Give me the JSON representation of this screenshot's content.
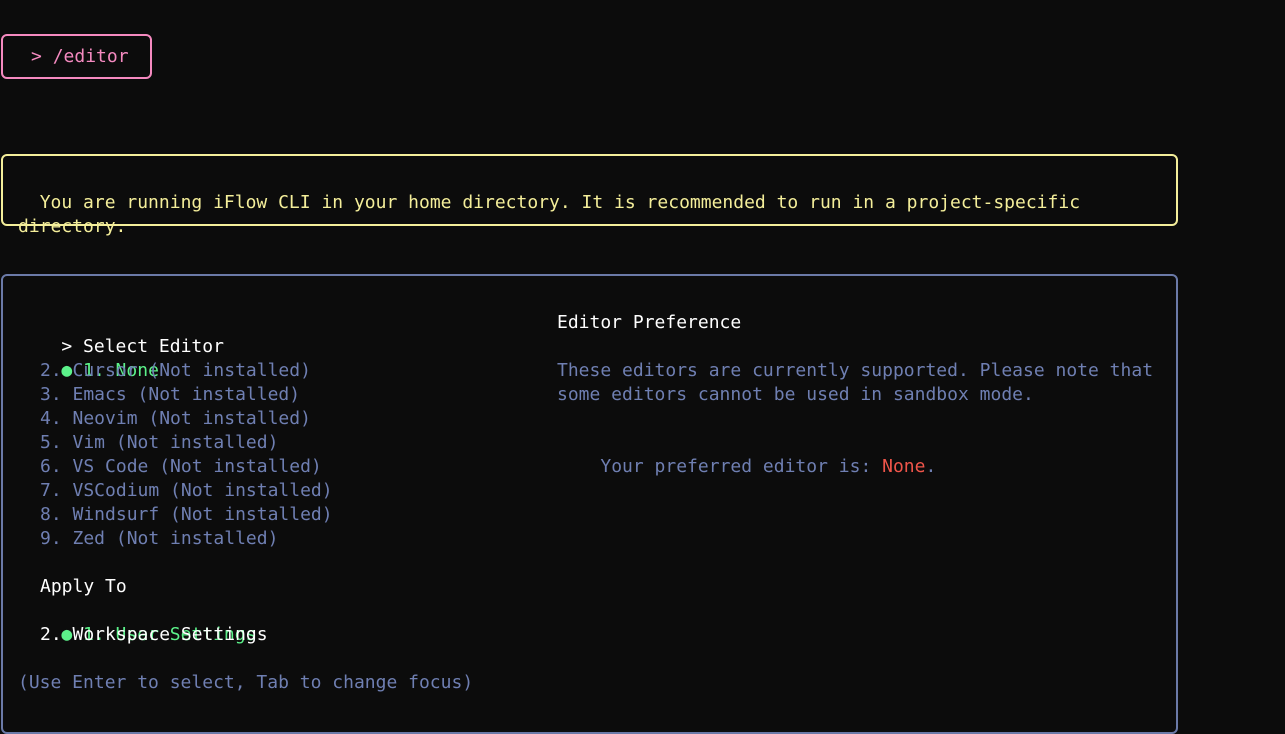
{
  "command": {
    "prompt": ">",
    "text": "/editor"
  },
  "warning": {
    "text": "You are running iFlow CLI in your home directory. It is recommended to run in a project-specific\ndirectory."
  },
  "editor_select": {
    "heading_marker": ">",
    "heading": "Select Editor",
    "selected_bullet": "●",
    "items": [
      {
        "label": "1. None",
        "selected": true
      },
      {
        "label": "2. Cursor (Not installed)",
        "selected": false
      },
      {
        "label": "3. Emacs (Not installed)",
        "selected": false
      },
      {
        "label": "4. Neovim (Not installed)",
        "selected": false
      },
      {
        "label": "5. Vim (Not installed)",
        "selected": false
      },
      {
        "label": "6. VS Code (Not installed)",
        "selected": false
      },
      {
        "label": "7. VSCodium (Not installed)",
        "selected": false
      },
      {
        "label": "8. Windsurf (Not installed)",
        "selected": false
      },
      {
        "label": "9. Zed (Not installed)",
        "selected": false
      }
    ]
  },
  "apply_to": {
    "heading": "Apply To",
    "selected_bullet": "●",
    "items": [
      {
        "label": "1. User Settings",
        "selected": true
      },
      {
        "label": "2. Workspace Settings",
        "selected": false
      }
    ]
  },
  "footer_hint": "(Use Enter to select, Tab to change focus)",
  "preference_panel": {
    "title": "Editor Preference",
    "description_line1": "These editors are currently supported. Please note that",
    "description_line2": "some editors cannot be used in sandbox mode.",
    "preferred_prefix": "Your preferred editor is: ",
    "preferred_value": "None",
    "preferred_suffix": "."
  },
  "colors": {
    "background": "#0c0c0c",
    "command_border": "#f58ac0",
    "warning": "#f4ee9a",
    "dialog_border": "#6b7aa8",
    "selected": "#5cf28a",
    "muted": "#6f7fb2",
    "highlight_value": "#f0554a"
  }
}
